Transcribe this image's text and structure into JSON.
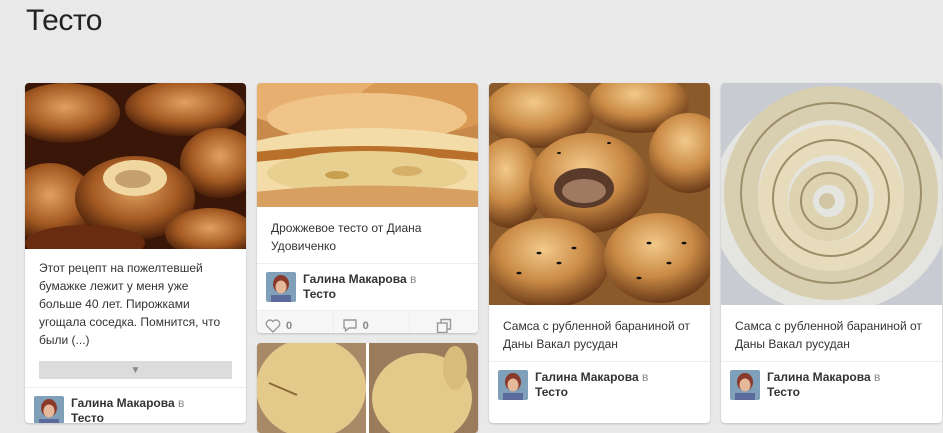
{
  "page": {
    "title": "Тесто"
  },
  "colors": {
    "background": "#e9e9e9",
    "card": "#ffffff",
    "expand_bar": "#dcdcdc"
  },
  "pins": [
    {
      "description": "Этот рецепт на пожелтевшей бумажке лежит у меня уже больше 40 лет. Пирожками угощала соседка. Помнится, что были (...)",
      "author": "Галина Макарова",
      "in_word": "в",
      "board": "Тесто",
      "expand_icon": "chevron-down-icon"
    },
    {
      "description": "Дрожжевое тесто от Диана Удовиченко",
      "author": "Галина Макарова",
      "in_word": "в",
      "board": "Тесто",
      "likes": "0",
      "comments": "0",
      "repin_icon": "repin-icon"
    },
    {
      "description": "Самса с рубленной бараниной от Даны Вакал русудан",
      "author": "Галина Макарова",
      "in_word": "в",
      "board": "Тесто"
    },
    {
      "description": "Самса с рубленной бараниной от Даны Вакал русудан",
      "author": "Галина Макарова",
      "in_word": "в",
      "board": "Тесто"
    }
  ]
}
